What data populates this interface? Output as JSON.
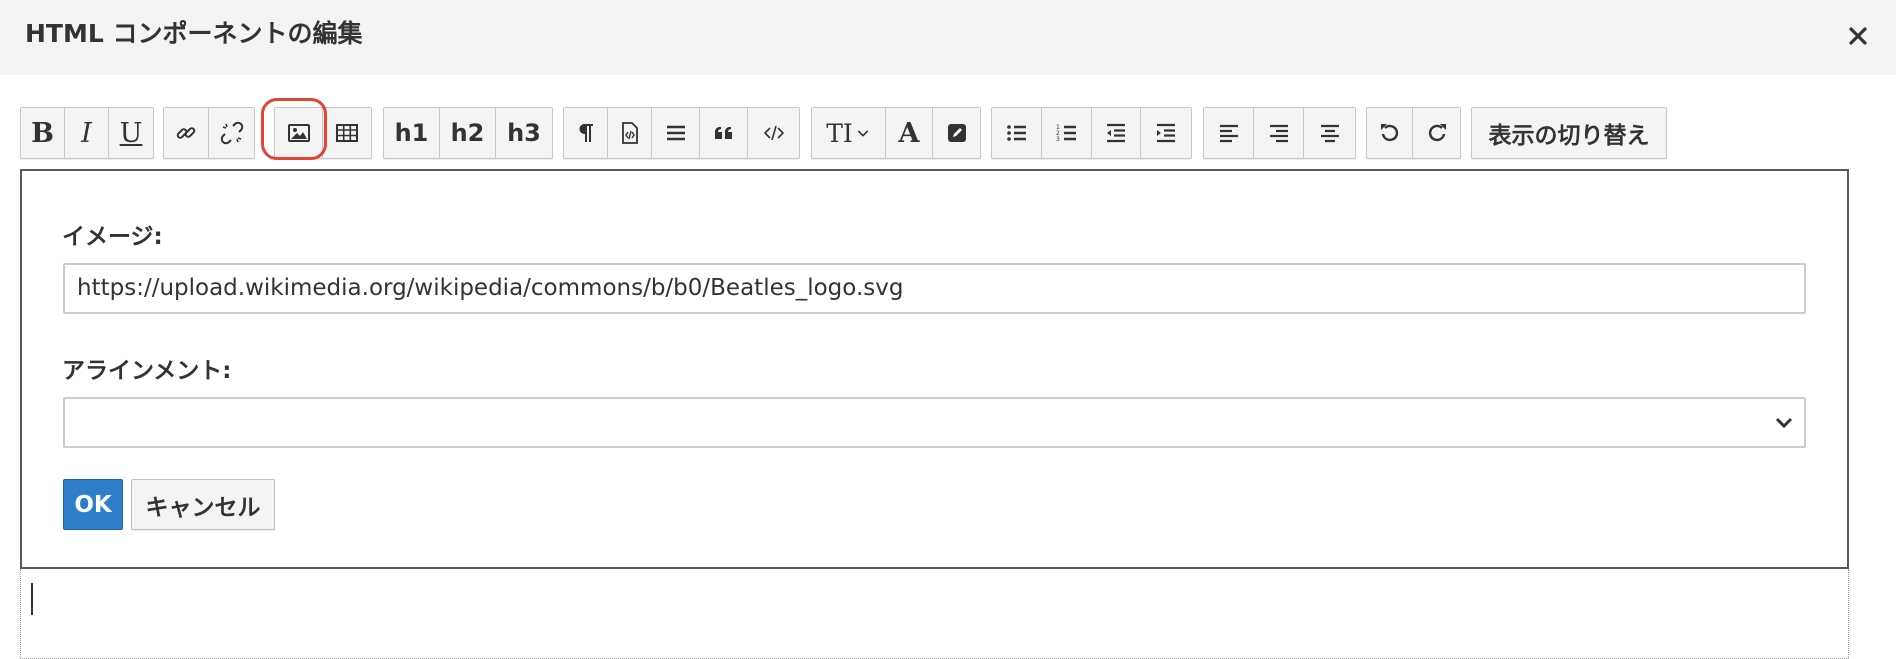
{
  "dialog": {
    "title": "HTML コンポーネントの編集",
    "close_icon": "close-icon"
  },
  "toolbar": {
    "bold_label": "B",
    "italic_label": "I",
    "underline_label": "U",
    "h1_label": "h1",
    "h2_label": "h2",
    "h3_label": "h3",
    "fontsize_label": "TI",
    "fontcolor_label": "A",
    "toggle_view_label": "表示の切り替え",
    "highlighted_button": "insert-image-button",
    "highlight_color": "#e44434"
  },
  "image_form": {
    "image_label": "イメージ:",
    "image_value": "https://upload.wikimedia.org/wikipedia/commons/b/b0/Beatles_logo.svg",
    "alignment_label": "アラインメント:",
    "alignment_value": "",
    "ok_label": "OK",
    "cancel_label": "キャンセル"
  },
  "colors": {
    "primary_button": "#2f7ec9",
    "header_bg": "#f4f4f4"
  }
}
